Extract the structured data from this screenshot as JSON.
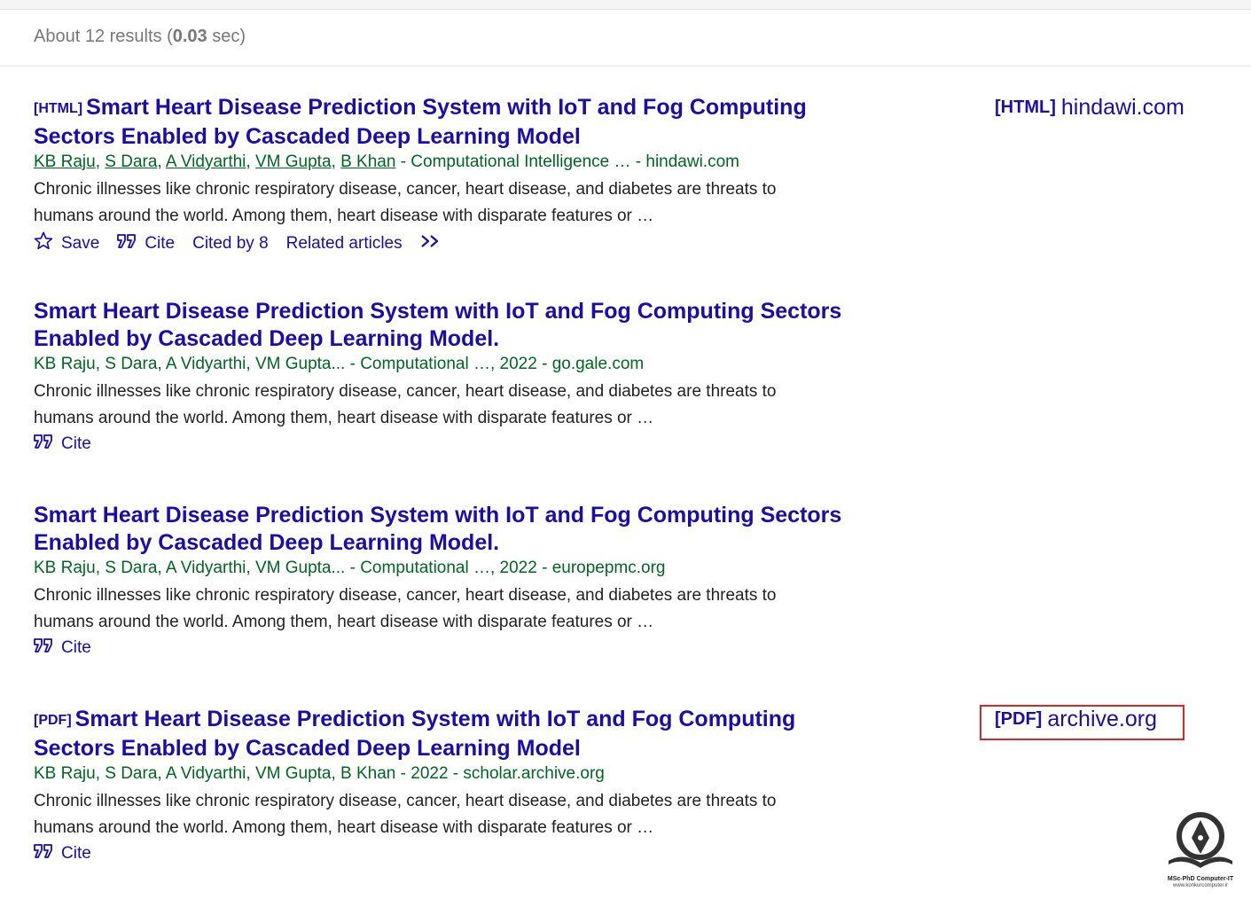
{
  "stats": {
    "prefix": "About 12 results (",
    "time": "0.03",
    "suffix": " sec)"
  },
  "results": [
    {
      "tag": "[HTML]",
      "title": "Smart Heart Disease Prediction System with IoT and Fog Computing Sectors Enabled by Cascaded Deep Learning Model",
      "authors": [
        "KB Raju",
        "S Dara",
        "A Vidyarthi",
        "VM Gupta",
        "B Khan"
      ],
      "source": " - Computational Intelligence … - hindawi.com",
      "snippet": "Chronic illnesses like chronic respiratory disease, cancer, heart disease, and diabetes are threats to humans around the world. Among them, heart disease with disparate features or …",
      "actions": {
        "save": "Save",
        "cite": "Cite",
        "cited_by": "Cited by 8",
        "related": "Related articles"
      },
      "side": {
        "tag": "[HTML]",
        "domain": "hindawi.com"
      }
    },
    {
      "title": "Smart Heart Disease Prediction System with IoT and Fog Computing Sectors Enabled by Cascaded Deep Learning Model.",
      "meta": "KB Raju, S Dara, A Vidyarthi, VM Gupta... - Computational …, 2022 - go.gale.com",
      "snippet": "Chronic illnesses like chronic respiratory disease, cancer, heart disease, and diabetes are threats to humans around the world. Among them, heart disease with disparate features or …",
      "actions": {
        "cite": "Cite"
      }
    },
    {
      "title": "Smart Heart Disease Prediction System with IoT and Fog Computing Sectors Enabled by Cascaded Deep Learning Model.",
      "meta": "KB Raju, S Dara, A Vidyarthi, VM Gupta... - Computational …, 2022 - europepmc.org",
      "snippet": "Chronic illnesses like chronic respiratory disease, cancer, heart disease, and diabetes are threats to humans around the world. Among them, heart disease with disparate features or …",
      "actions": {
        "cite": "Cite"
      }
    },
    {
      "tag": "[PDF]",
      "title": "Smart Heart Disease Prediction System with IoT and Fog Computing Sectors Enabled by Cascaded Deep Learning Model",
      "meta": "KB Raju, S Dara, A Vidyarthi, VM Gupta, B Khan - 2022 - scholar.archive.org",
      "snippet": "Chronic illnesses like chronic respiratory disease, cancer, heart disease, and diabetes are threats to humans around the world. Among them, heart disease with disparate features or …",
      "actions": {
        "cite": "Cite"
      },
      "side": {
        "tag": "[PDF]",
        "domain": "archive.org"
      }
    }
  ],
  "logo": {
    "line1": "MSc-PhD Computer-IT",
    "line2": "www.konkurcomputer.ir"
  },
  "colors": {
    "link": "#1a0dab",
    "meta": "#006621",
    "highlight": "#d62828"
  },
  "icons": {
    "save": "star-icon",
    "cite": "quote-icon",
    "more": "double-chevron-icon"
  }
}
